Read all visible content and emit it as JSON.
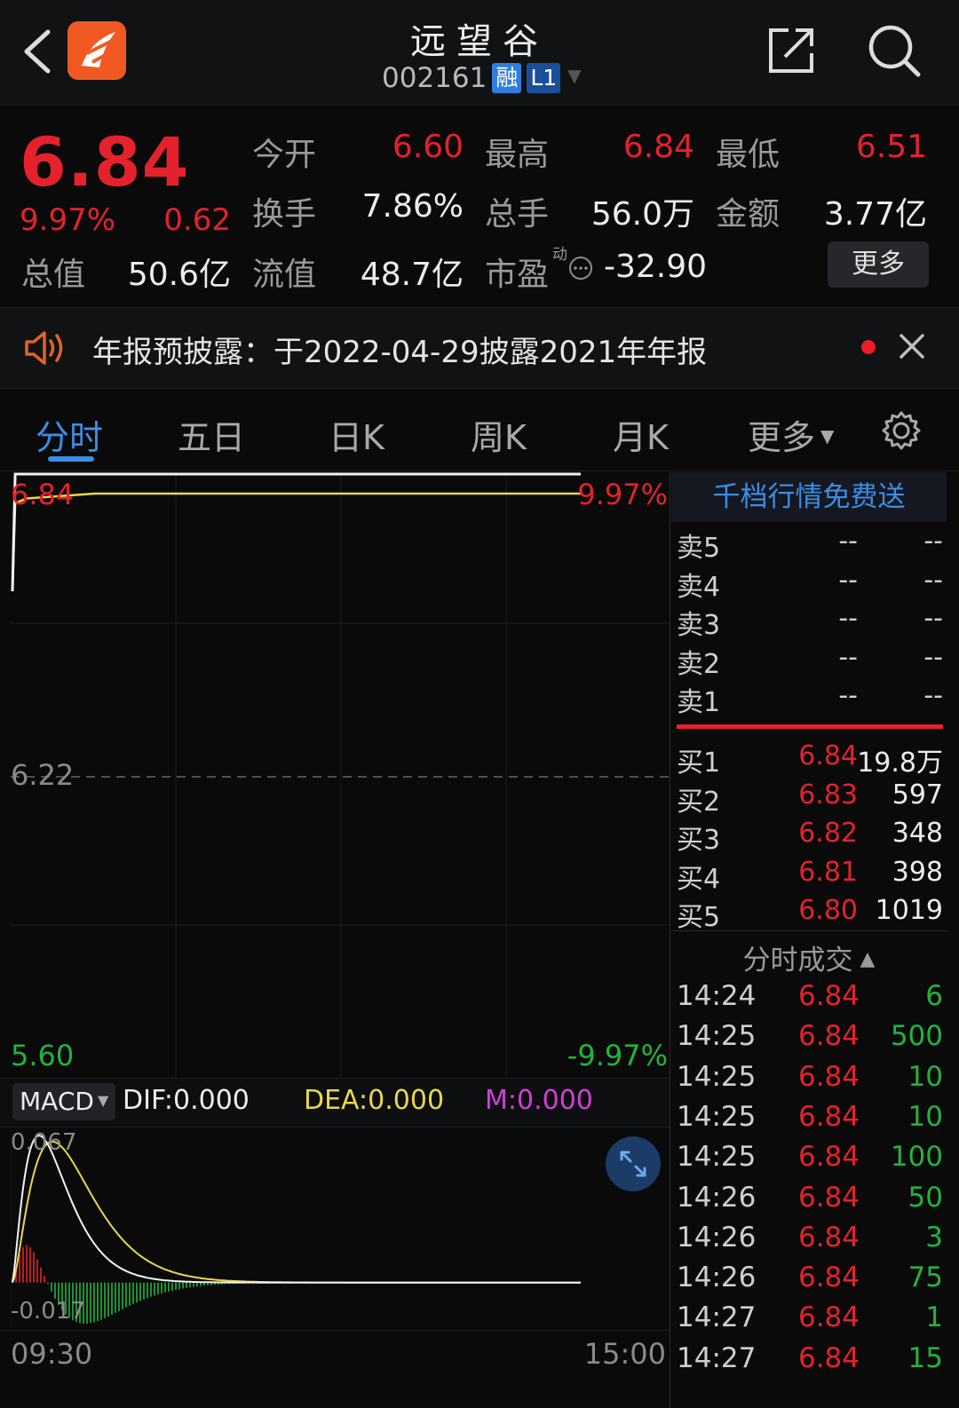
{
  "header": {
    "title": "远望谷",
    "code": "002161",
    "badge_margin": "融",
    "badge_level": "L1"
  },
  "quote": {
    "price": "6.84",
    "change_pct": "9.97%",
    "change": "0.62",
    "market_cap_label": "总值",
    "market_cap": "50.6亿",
    "open_label": "今开",
    "open": "6.60",
    "high_label": "最高",
    "high": "6.84",
    "low_label": "最低",
    "low": "6.51",
    "turnover_label": "换手",
    "turnover": "7.86%",
    "volume_label": "总手",
    "volume": "56.0万",
    "amount_label": "金额",
    "amount": "3.77亿",
    "float_cap_label": "流值",
    "float_cap": "48.7亿",
    "pe_label": "市盈",
    "pe_superscript": "动",
    "pe": "-32.90",
    "more_label": "更多"
  },
  "notice": {
    "text": "年报预披露：于2022-04-29披露2021年年报"
  },
  "tabs": [
    {
      "label": "分时",
      "active": true
    },
    {
      "label": "五日"
    },
    {
      "label": "日K"
    },
    {
      "label": "周K"
    },
    {
      "label": "月K"
    },
    {
      "label": "更多"
    }
  ],
  "chart": {
    "price_top": "6.84",
    "price_mid": "6.22",
    "price_bottom": "5.60",
    "pct_top": "9.97%",
    "pct_bottom": "-9.97%",
    "time_start": "09:30",
    "time_end": "15:00"
  },
  "chart_data": {
    "type": "line",
    "title": "",
    "ylim": [
      5.6,
      6.84
    ],
    "reference_price": 6.22,
    "x": [
      "09:30",
      "09:31",
      "09:35",
      "10:00",
      "11:30",
      "13:00",
      "14:27"
    ],
    "series": [
      {
        "values": [
          6.6,
          6.84,
          6.84,
          6.84,
          6.84,
          6.84,
          6.84
        ]
      },
      {
        "values": [
          6.6,
          6.78,
          6.79,
          6.8,
          6.8,
          6.8,
          6.8
        ]
      }
    ]
  },
  "macd": {
    "selector": "MACD",
    "dif": "DIF:0.000",
    "dea": "DEA:0.000",
    "m": "M:0.000",
    "max_label": "0.067",
    "min_label": "-0.017",
    "ylim": [
      -0.017,
      0.067
    ]
  },
  "orderbook": {
    "banner": "千档行情免费送",
    "asks": [
      {
        "label": "卖5",
        "price": "--",
        "vol": "--"
      },
      {
        "label": "卖4",
        "price": "--",
        "vol": "--"
      },
      {
        "label": "卖3",
        "price": "--",
        "vol": "--"
      },
      {
        "label": "卖2",
        "price": "--",
        "vol": "--"
      },
      {
        "label": "卖1",
        "price": "--",
        "vol": "--"
      }
    ],
    "bids": [
      {
        "label": "买1",
        "price": "6.84",
        "vol": "19.8万"
      },
      {
        "label": "买2",
        "price": "6.83",
        "vol": "597"
      },
      {
        "label": "买3",
        "price": "6.82",
        "vol": "348"
      },
      {
        "label": "买4",
        "price": "6.81",
        "vol": "398"
      },
      {
        "label": "买5",
        "price": "6.80",
        "vol": "1019"
      }
    ]
  },
  "trades": {
    "title": "分时成交",
    "rows": [
      {
        "time": "14:24",
        "price": "6.84",
        "vol": "6"
      },
      {
        "time": "14:25",
        "price": "6.84",
        "vol": "500"
      },
      {
        "time": "14:25",
        "price": "6.84",
        "vol": "10"
      },
      {
        "time": "14:25",
        "price": "6.84",
        "vol": "10"
      },
      {
        "time": "14:25",
        "price": "6.84",
        "vol": "100"
      },
      {
        "time": "14:26",
        "price": "6.84",
        "vol": "50"
      },
      {
        "time": "14:26",
        "price": "6.84",
        "vol": "3"
      },
      {
        "time": "14:26",
        "price": "6.84",
        "vol": "75"
      },
      {
        "time": "14:27",
        "price": "6.84",
        "vol": "1"
      },
      {
        "time": "14:27",
        "price": "6.84",
        "vol": "15"
      }
    ]
  },
  "colors": {
    "up": "#e4222b",
    "down": "#21b43a",
    "accent": "#3a8ee6",
    "price_line": "#f2f2f2",
    "avg_line": "#e8d84a",
    "dea": "#e8d84a",
    "m": "#d23fd6"
  }
}
